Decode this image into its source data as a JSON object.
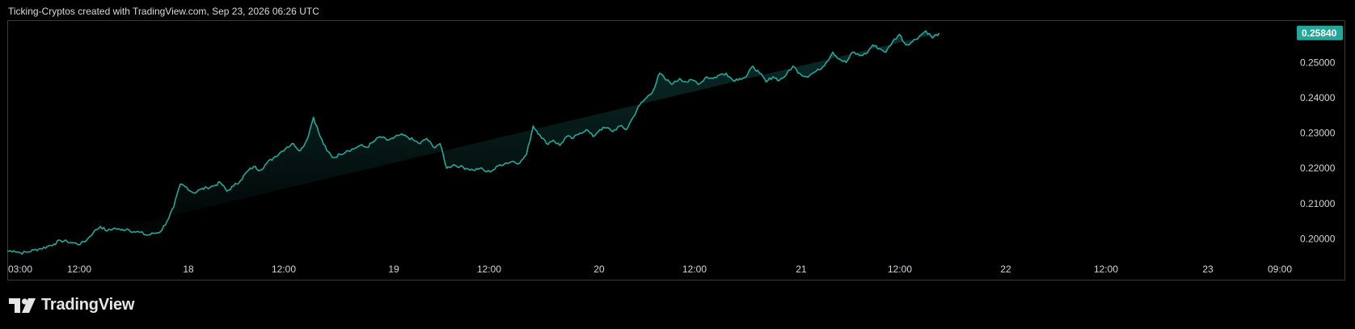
{
  "header": {
    "attribution": "Ticking-Cryptos created with TradingView.com, Sep 23, 2026 06:26 UTC"
  },
  "brand": {
    "name": "TradingView"
  },
  "colors": {
    "line": "#26a69a",
    "price_badge": "#26a69a",
    "axis_text": "#d1d4dc",
    "background": "#000000"
  },
  "chart_data": {
    "type": "area",
    "title": "",
    "xlabel": "",
    "ylabel": "",
    "grid": false,
    "y_axis_position": "right",
    "x_tick_labels": [
      "03:00",
      "12:00",
      "18",
      "12:00",
      "19",
      "12:00",
      "20",
      "12:00",
      "21",
      "12:00",
      "22",
      "12:00",
      "23",
      "09:00"
    ],
    "y_tick_labels": [
      "0.25000",
      "0.24000",
      "0.23000",
      "0.22000",
      "0.21000",
      "0.20000"
    ],
    "y_ticks": [
      0.25,
      0.24,
      0.23,
      0.22,
      0.21,
      0.2
    ],
    "ylim": [
      0.1955,
      0.2618
    ],
    "last_price": 0.2584,
    "last_price_label": "0.25840",
    "x_hours": [
      0,
      3,
      6,
      9,
      12,
      15,
      18,
      21,
      24,
      27,
      30,
      33,
      36,
      39,
      42,
      45,
      48,
      51,
      54,
      57,
      60,
      63,
      66,
      69,
      72,
      75,
      78,
      81,
      84,
      87,
      90,
      93,
      96,
      99,
      102,
      105,
      108,
      111,
      114,
      117,
      120,
      123,
      126,
      129,
      132,
      135,
      138,
      141,
      144,
      147,
      150,
      153,
      156,
      159,
      162,
      165,
      168,
      171,
      174,
      177,
      180,
      183,
      186,
      189,
      192
    ],
    "values": [
      0.1963,
      0.1965,
      0.1965,
      0.197,
      0.1973,
      0.1977,
      0.1982,
      0.1989,
      0.1997,
      0.1996,
      0.199,
      0.1987,
      0.201,
      0.2025,
      0.2025,
      0.203,
      0.2021,
      0.2029,
      0.2022,
      0.202,
      0.2018,
      0.2015,
      0.2005,
      0.201,
      0.203,
      0.211,
      0.2155,
      0.2133,
      0.2142,
      0.2148,
      0.2153,
      0.2155,
      0.2163,
      0.2143,
      0.2148,
      0.2152,
      0.2155,
      0.217,
      0.219,
      0.2208,
      0.223,
      0.2245,
      0.2265,
      0.2285,
      0.2285,
      0.2295,
      0.2305,
      0.2325,
      0.2345,
      0.2292,
      0.226,
      0.2232,
      0.2248,
      0.226,
      0.2262,
      0.2268,
      0.2273,
      0.227,
      0.2275,
      0.228,
      0.2284,
      0.2275,
      0.2271,
      0.2268,
      0.2266
    ],
    "series": [
      {
        "name": "",
        "x_hours": [
          0,
          2,
          4,
          6,
          8,
          10,
          12,
          14,
          16,
          18,
          20,
          22,
          24,
          26,
          28,
          30,
          32,
          34,
          36,
          38,
          40,
          42,
          44,
          46,
          48,
          50,
          52,
          54,
          56,
          58,
          60,
          62,
          64,
          66,
          68,
          70,
          72,
          74,
          76,
          78,
          80,
          82,
          84,
          86,
          88,
          90,
          92,
          94,
          96,
          98,
          100,
          102,
          104,
          106,
          108,
          110,
          112,
          114,
          116,
          118,
          120,
          122,
          124,
          126,
          128,
          130,
          132,
          134,
          136,
          138,
          140,
          142,
          144,
          146,
          148,
          150,
          152,
          154,
          156,
          158,
          160,
          162,
          164,
          166,
          168,
          170,
          172,
          174,
          176,
          178,
          180,
          182,
          184,
          186,
          188,
          190,
          192,
          194,
          196,
          198,
          200,
          202,
          204,
          206,
          208,
          210,
          212,
          214,
          216,
          218,
          220,
          222,
          224,
          226,
          228,
          230,
          232,
          234,
          236,
          238,
          240,
          242,
          244,
          246,
          248,
          250,
          252,
          254,
          256,
          258,
          260,
          262,
          264,
          266,
          268,
          270,
          272,
          274,
          276,
          278,
          280,
          282,
          284,
          286,
          288,
          290,
          292,
          294,
          296,
          298,
          300,
          302,
          304,
          306,
          308,
          310,
          312,
          314,
          316,
          318,
          320,
          322,
          324,
          326,
          328,
          330,
          332,
          334,
          336,
          338,
          340,
          342,
          344,
          346,
          348,
          350,
          352,
          354,
          356,
          358,
          360,
          362,
          364,
          366,
          368,
          370,
          372,
          374,
          376,
          378,
          380,
          382,
          384
        ],
        "values": [
          0.1965,
          0.1966,
          0.196,
          0.1962,
          0.1968,
          0.1972,
          0.1978,
          0.1985,
          0.1995,
          0.1992,
          0.1988,
          0.1985,
          0.1998,
          0.202,
          0.2035,
          0.2022,
          0.203,
          0.2025,
          0.2028,
          0.202,
          0.2018,
          0.201,
          0.2015,
          0.202,
          0.205,
          0.209,
          0.2155,
          0.2145,
          0.213,
          0.214,
          0.2145,
          0.215,
          0.216,
          0.2135,
          0.215,
          0.2165,
          0.219,
          0.2205,
          0.2195,
          0.2215,
          0.223,
          0.2245,
          0.226,
          0.227,
          0.225,
          0.228,
          0.2345,
          0.229,
          0.225,
          0.223,
          0.224,
          0.225,
          0.2255,
          0.2265,
          0.226,
          0.2275,
          0.229,
          0.228,
          0.2285,
          0.2295,
          0.229,
          0.228,
          0.227,
          0.2285,
          0.226,
          0.227,
          0.22,
          0.221,
          0.2205,
          0.22,
          0.2195,
          0.22,
          0.219,
          0.2195,
          0.221,
          0.2215,
          0.222,
          0.2215,
          0.224,
          0.232,
          0.2295,
          0.227,
          0.228,
          0.2265,
          0.229,
          0.2285,
          0.23,
          0.231,
          0.229,
          0.231,
          0.2315,
          0.2305,
          0.232,
          0.231,
          0.2345,
          0.238,
          0.24,
          0.242,
          0.247,
          0.245,
          0.244,
          0.2455,
          0.2445,
          0.245,
          0.244,
          0.246,
          0.2455,
          0.2465,
          0.247,
          0.245,
          0.2455,
          0.246,
          0.249,
          0.247,
          0.2445,
          0.246,
          0.245,
          0.2465,
          0.249,
          0.247,
          0.246,
          0.247,
          0.248,
          0.25,
          0.253,
          0.251,
          0.25,
          0.253,
          0.252,
          0.2525,
          0.255,
          0.254,
          0.253,
          0.256,
          0.258,
          0.255,
          0.256,
          0.2575,
          0.259,
          0.257,
          0.2584
        ]
      }
    ]
  }
}
